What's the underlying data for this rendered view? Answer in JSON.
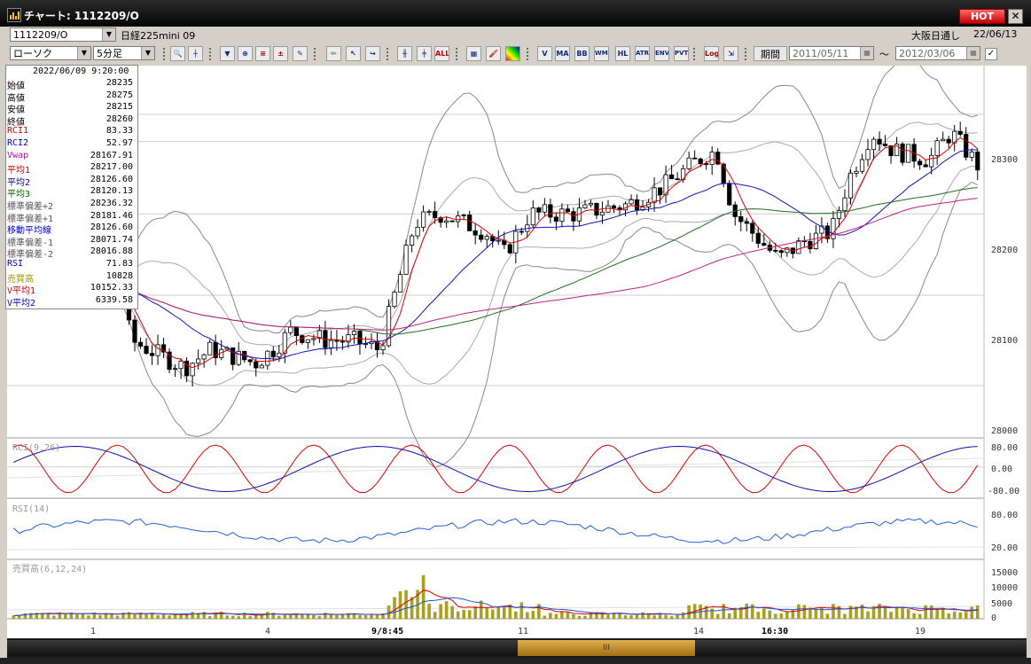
{
  "window": {
    "title": "チャート: 1112209/O",
    "hot_label": "HOT",
    "close_label": "✕"
  },
  "toolbar1": {
    "symbol_value": "1112209/O",
    "symbol_name": "日経225mini 09",
    "chart_type": "ローソク",
    "interval": "5分足",
    "session_label": "大阪日通し",
    "date_label": "22/06/13"
  },
  "toolbar2": {
    "period_label": "期間",
    "date_from": "2011/05/11",
    "date_to": "2012/03/06",
    "tilde": "〜",
    "buttons": [
      "ALL",
      "MA",
      "BB",
      "WMA",
      "HL",
      "ATR",
      "ENV",
      "PVT",
      "Log"
    ]
  },
  "info": {
    "timestamp": "2022/06/09  9:20:00",
    "rows": [
      {
        "label": "始値",
        "value": "28235",
        "color": "#000000"
      },
      {
        "label": "高値",
        "value": "28275",
        "color": "#000000"
      },
      {
        "label": "安値",
        "value": "28215",
        "color": "#000000"
      },
      {
        "label": "終値",
        "value": "28260",
        "color": "#000000"
      },
      {
        "label": "RCI1",
        "value": "83.33",
        "color": "#cc0000"
      },
      {
        "label": "RCI2",
        "value": "52.97",
        "color": "#0000cc"
      },
      {
        "label": "Vwap",
        "value": "28167.91",
        "color": "#cc00cc"
      },
      {
        "label": "平均1",
        "value": "28217.00",
        "color": "#cc0000"
      },
      {
        "label": "平均2",
        "value": "28126.60",
        "color": "#000080"
      },
      {
        "label": "平均3",
        "value": "28120.13",
        "color": "#006600"
      },
      {
        "label": "標準偏差+2",
        "value": "28236.32",
        "color": "#555555"
      },
      {
        "label": "標準偏差+1",
        "value": "28181.46",
        "color": "#555555"
      },
      {
        "label": "移動平均線",
        "value": "28126.60",
        "color": "#0000cc"
      },
      {
        "label": "標準偏差-1",
        "value": "28071.74",
        "color": "#555555"
      },
      {
        "label": "標準偏差-2",
        "value": "28016.88",
        "color": "#555555"
      },
      {
        "label": "RSI",
        "value": "71.83",
        "color": "#0000cc"
      },
      {
        "label": "売買高",
        "value": "10828",
        "color": "#999900"
      },
      {
        "label": "V平均1",
        "value": "10152.33",
        "color": "#cc0000"
      },
      {
        "label": "V平均2",
        "value": "6339.58",
        "color": "#0000cc"
      }
    ]
  },
  "chart_data": [
    {
      "type": "candlestick",
      "price_axis": {
        "ticks": [
          "28300",
          "28200",
          "28100",
          "28000"
        ],
        "range": [
          28000,
          28370
        ]
      },
      "time_labels": [
        "1",
        "4",
        "9/8:45",
        "11",
        "14",
        "16:30",
        "19"
      ],
      "overlays": [
        "平均1",
        "平均2",
        "平均3",
        "Vwap",
        "標準偏差±1",
        "標準偏差±2"
      ]
    },
    {
      "type": "line",
      "title": "RCI(9,26)",
      "yticks": [
        "80.00",
        "0.00",
        "-80.00"
      ],
      "ylim": [
        -100,
        100
      ],
      "series": [
        {
          "name": "RCI1",
          "color": "#dd0000"
        },
        {
          "name": "RCI2",
          "color": "#1010b0"
        }
      ]
    },
    {
      "type": "line",
      "title": "RSI(14)",
      "yticks": [
        "80.00",
        "20.00"
      ],
      "ylim": [
        0,
        100
      ],
      "series": [
        {
          "name": "RSI",
          "color": "#2060dd"
        }
      ]
    },
    {
      "type": "bar",
      "title": "売買高(6,12,24)",
      "yticks": [
        "15000",
        "10000",
        "5000",
        "0"
      ],
      "ylim": [
        0,
        17000
      ],
      "series": [
        {
          "name": "売買高",
          "color": "#a8a020"
        },
        {
          "name": "V平均1",
          "color": "#dd0000"
        },
        {
          "name": "V平均2",
          "color": "#2050dd"
        }
      ]
    }
  ],
  "scroll": {
    "thumb_label": "III"
  }
}
